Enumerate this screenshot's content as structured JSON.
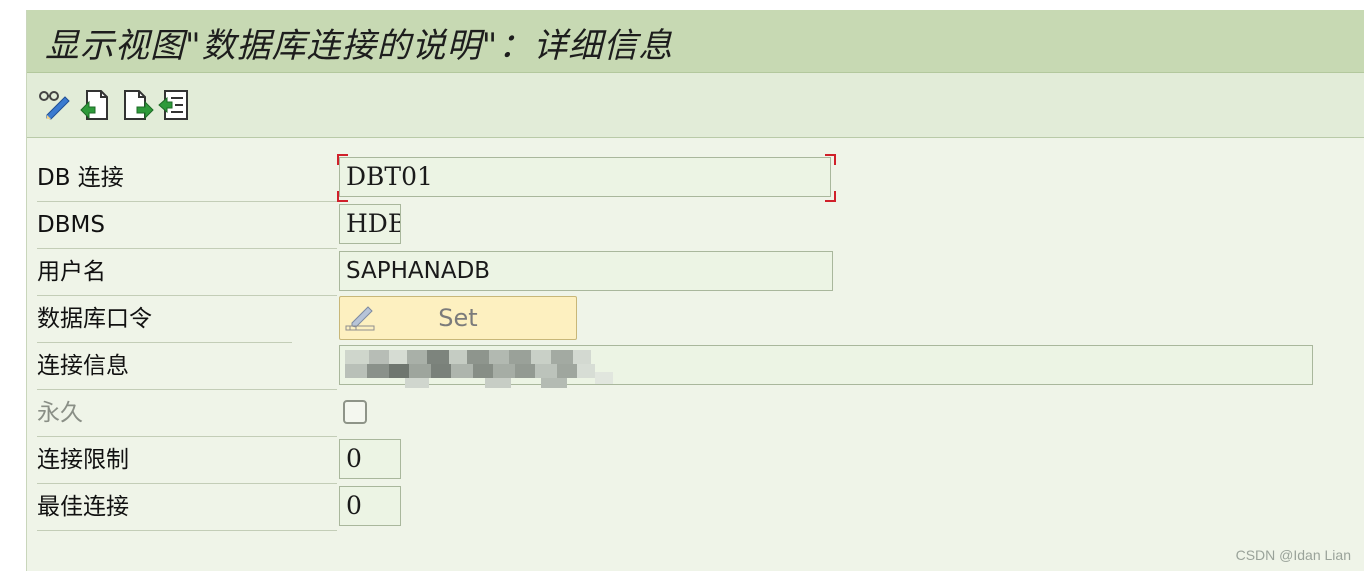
{
  "window": {
    "title": "显示视图\"数据库连接的说明\"：详细信息"
  },
  "toolbar": {
    "buttons": [
      {
        "icon": "display-change-icon"
      },
      {
        "icon": "previous-entry-icon"
      },
      {
        "icon": "next-entry-icon"
      },
      {
        "icon": "other-entry-icon"
      }
    ]
  },
  "form": {
    "db_connection": {
      "label": "DB 连接",
      "value": "DBT01"
    },
    "dbms": {
      "label": "DBMS",
      "value": "HDB"
    },
    "username": {
      "label": "用户名",
      "value": "SAPHANADB"
    },
    "db_password": {
      "label": "数据库口令",
      "button_label": "Set"
    },
    "connection_info": {
      "label": "连接信息"
    },
    "permanent": {
      "label": "永久",
      "checked": false
    },
    "connection_limit": {
      "label": "连接限制",
      "value": "0"
    },
    "optimal_connections": {
      "label": "最佳连接",
      "value": "0"
    }
  },
  "watermark": "CSDN @Idan Lian",
  "colors": {
    "title_bar": "#c7d9b3",
    "toolbar": "#e2ecd8",
    "background": "#eff4e8",
    "focus_frame": "#d0202a",
    "set_button": "#fdf0c0"
  }
}
